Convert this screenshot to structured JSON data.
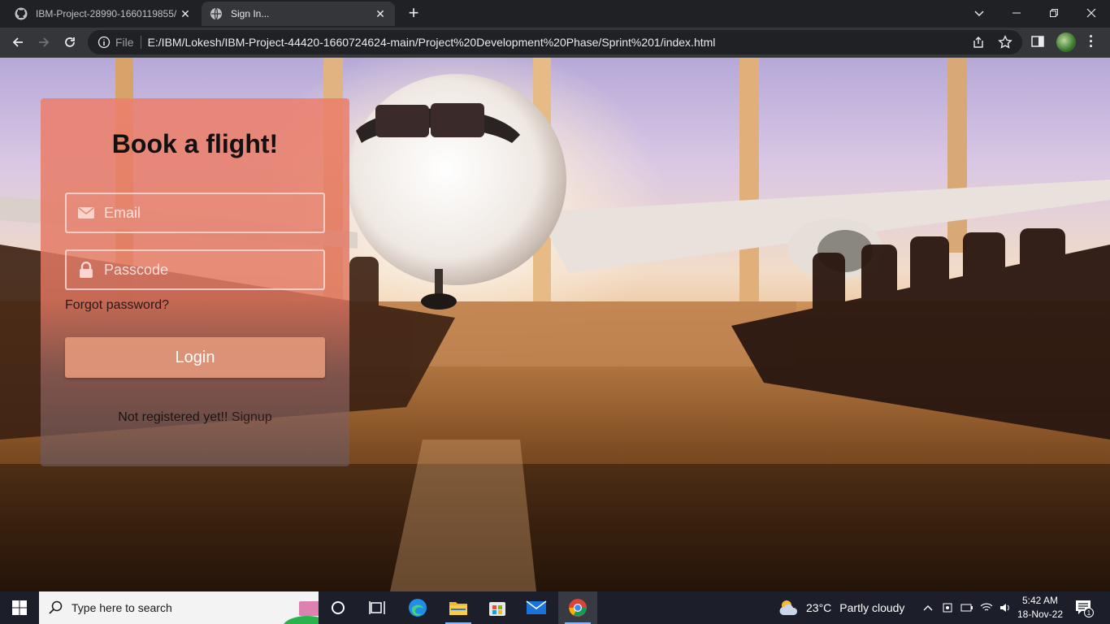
{
  "browser": {
    "tabs": [
      {
        "title": "IBM-Project-28990-1660119855/",
        "active": false,
        "favicon": "github-icon"
      },
      {
        "title": "Sign In...",
        "active": true,
        "favicon": "globe-icon"
      }
    ],
    "new_tab_label": "+",
    "omnibox": {
      "scheme_label": "File",
      "url": "E:/IBM/Lokesh/IBM-Project-44420-1660724624-main/Project%20Development%20Phase/Sprint%201/index.html"
    }
  },
  "page": {
    "heading": "Book a flight!",
    "email_placeholder": "Email",
    "passcode_placeholder": "Passcode",
    "forgot_password": "Forgot password?",
    "login_button": "Login",
    "signup_prompt": "Not registered yet!!",
    "signup_link": "Signup",
    "colors": {
      "card_top": "#ec806c",
      "button": "#df9678",
      "heading_text": "#111111"
    }
  },
  "taskbar": {
    "search_placeholder": "Type here to search",
    "weather_temp": "23°C",
    "weather_condition": "Partly cloudy",
    "time": "5:42 AM",
    "date": "18-Nov-22",
    "notification_count": "1"
  }
}
